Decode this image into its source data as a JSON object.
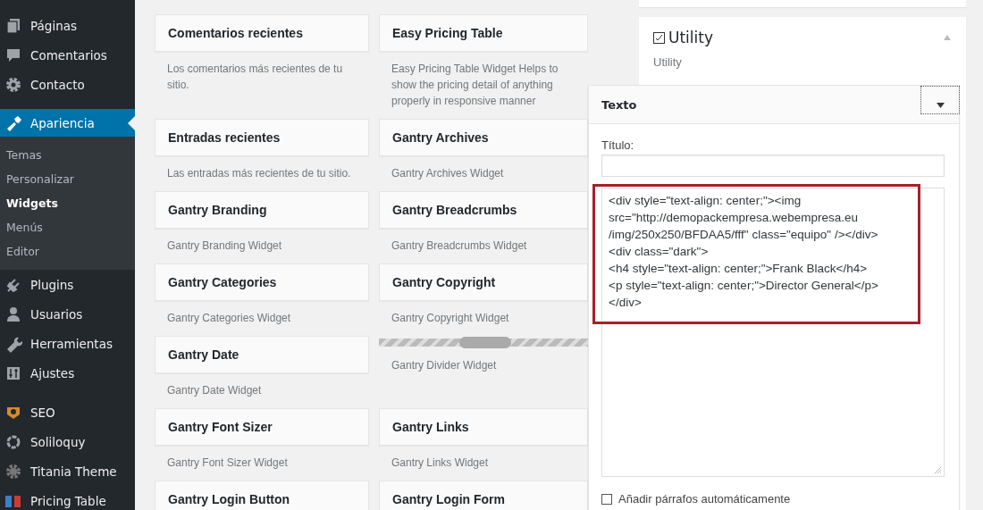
{
  "sidebar": {
    "items": [
      {
        "label": "Páginas",
        "selected": false
      },
      {
        "label": "Comentarios",
        "selected": false
      },
      {
        "label": "Contacto",
        "selected": false
      },
      {
        "label": "Apariencia",
        "selected": true,
        "submenu": [
          {
            "label": "Temas",
            "selected": false
          },
          {
            "label": "Personalizar",
            "selected": false
          },
          {
            "label": "Widgets",
            "selected": true
          },
          {
            "label": "Menús",
            "selected": false
          },
          {
            "label": "Editor",
            "selected": false
          }
        ]
      },
      {
        "label": "Plugins",
        "selected": false
      },
      {
        "label": "Usuarios",
        "selected": false
      },
      {
        "label": "Herramientas",
        "selected": false
      },
      {
        "label": "Ajustes",
        "selected": false
      },
      {
        "label": "SEO",
        "selected": false
      },
      {
        "label": "Soliloquy",
        "selected": false
      },
      {
        "label": "Titania Theme",
        "selected": false
      },
      {
        "label": "Pricing Table",
        "selected": false
      }
    ]
  },
  "widgets": [
    {
      "kind": "card",
      "title": "Comentarios recientes",
      "description": "Los comentarios más recientes de tu sitio."
    },
    {
      "kind": "card",
      "title": "Easy Pricing Table",
      "description": "Easy Pricing Table Widget Helps to show the pricing detail of anything properly in responsive manner"
    },
    {
      "kind": "card",
      "title": "Entradas recientes",
      "description": "Las entradas más recientes de tu sitio."
    },
    {
      "kind": "card",
      "title": "Gantry Archives",
      "description": "Gantry Archives Widget"
    },
    {
      "kind": "card",
      "title": "Gantry Branding",
      "description": "Gantry Branding Widget"
    },
    {
      "kind": "card",
      "title": "Gantry Breadcrumbs",
      "description": "Gantry Breadcrumbs Widget"
    },
    {
      "kind": "card",
      "title": "Gantry Categories",
      "description": "Gantry Categories Widget"
    },
    {
      "kind": "card",
      "title": "Gantry Copyright",
      "description": "Gantry Copyright Widget"
    },
    {
      "kind": "card",
      "title": "Gantry Date",
      "description": "Gantry Date Widget"
    },
    {
      "kind": "divider",
      "description": "Gantry Divider Widget"
    },
    {
      "kind": "card",
      "title": "Gantry Font Sizer",
      "description": "Gantry Font Sizer Widget"
    },
    {
      "kind": "card",
      "title": "Gantry Links",
      "description": "Gantry Links Widget"
    },
    {
      "kind": "card",
      "title": "Gantry Login Button"
    },
    {
      "kind": "card",
      "title": "Gantry Login Form"
    }
  ],
  "sidebar_area": {
    "title": "Utility",
    "description": "Utility",
    "expanded": true
  },
  "text_widget": {
    "title": "Texto",
    "expanded": true,
    "title_label": "Título:",
    "content_lines": [
      "<div style=\"text-align: center;\"><img",
      "src=\"http://demopackempresa.webempresa.eu",
      "/img/250x250/BFDAA5/fff\" class=\"equipo\" /></div>",
      "<div class=\"dark\">",
      "<h4 style=\"text-align: center;\">Frank Black</h4>",
      "<p style=\"text-align: center;\">Director General</p>",
      "</div>"
    ],
    "auto_paragraphs": {
      "label": "Añadir párrafos automáticamente",
      "checked": false
    }
  }
}
